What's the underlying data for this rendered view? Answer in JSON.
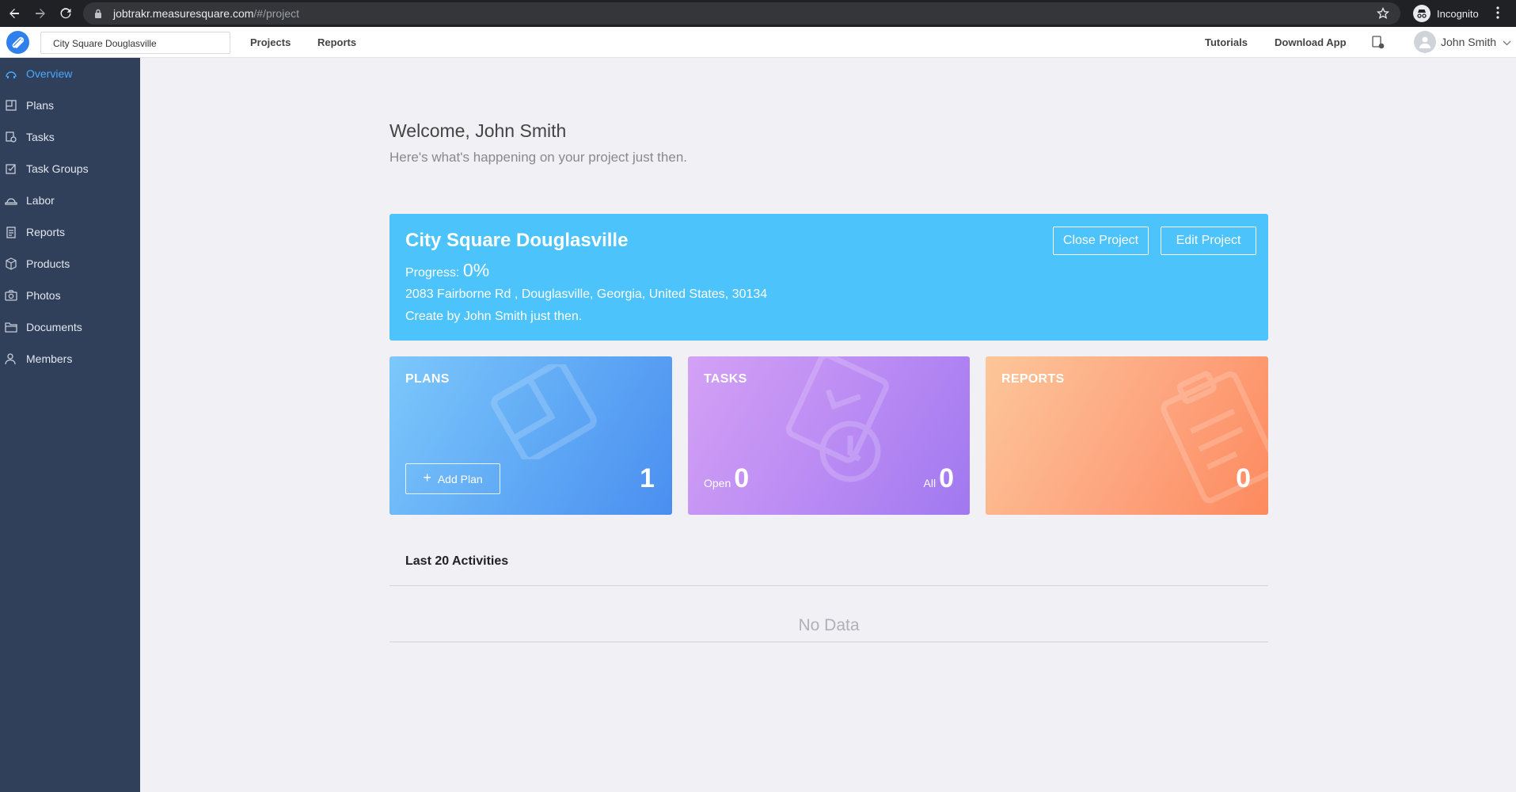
{
  "browser": {
    "url_host": "jobtrakr.measuresquare.com",
    "url_path": "/#/project",
    "incognito_label": "Incognito"
  },
  "header": {
    "project_selector": "City Square Douglasville",
    "nav": [
      "Projects",
      "Reports"
    ],
    "tutorials": "Tutorials",
    "download_app": "Download App",
    "user_name": "John Smith"
  },
  "sidebar": {
    "items": [
      {
        "label": "Overview",
        "icon": "overview-icon"
      },
      {
        "label": "Plans",
        "icon": "plans-icon"
      },
      {
        "label": "Tasks",
        "icon": "tasks-icon"
      },
      {
        "label": "Task Groups",
        "icon": "task-groups-icon"
      },
      {
        "label": "Labor",
        "icon": "labor-icon"
      },
      {
        "label": "Reports",
        "icon": "reports-icon"
      },
      {
        "label": "Products",
        "icon": "products-icon"
      },
      {
        "label": "Photos",
        "icon": "photos-icon"
      },
      {
        "label": "Documents",
        "icon": "documents-icon"
      },
      {
        "label": "Members",
        "icon": "members-icon"
      }
    ],
    "active": "Overview"
  },
  "main": {
    "welcome": "Welcome, John Smith",
    "subtitle": "Here's what's happening on your project just then.",
    "project": {
      "name": "City Square Douglasville",
      "progress_label": "Progress:",
      "progress_value": "0%",
      "address": "2083 Fairborne Rd , Douglasville, Georgia, United States, 30134",
      "created": "Create by John Smith just then.",
      "close_button": "Close Project",
      "edit_button": "Edit Project"
    },
    "cards": {
      "plans": {
        "title": "PLANS",
        "add_button": "Add Plan",
        "count": "1"
      },
      "tasks": {
        "title": "TASKS",
        "open_label": "Open",
        "open_count": "0",
        "all_label": "All",
        "all_count": "0"
      },
      "reports": {
        "title": "REPORTS",
        "count": "0"
      }
    },
    "activities": {
      "title": "Last 20 Activities",
      "empty": "No Data"
    }
  },
  "colors": {
    "sidebar_bg": "#30405a",
    "project_card": "#4dc3fb",
    "active_nav": "#4aa8ff"
  }
}
